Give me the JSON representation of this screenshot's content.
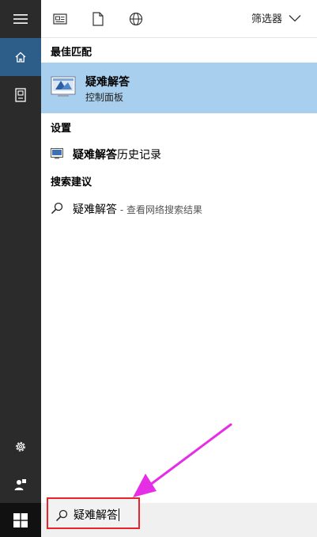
{
  "topbar": {
    "filter_label": "筛选器"
  },
  "sections": {
    "best_match": "最佳匹配",
    "settings": "设置",
    "suggestions": "搜索建议"
  },
  "best_match": {
    "title": "疑难解答",
    "subtitle": "控制面板"
  },
  "settings_item": {
    "bold": "疑难解答",
    "rest": "历史记录"
  },
  "suggestion_item": {
    "text": "疑难解答",
    "suffix": " - 查看网络搜索结果"
  },
  "search": {
    "value": "疑难解答"
  },
  "colors": {
    "rail": "#2b2b2b",
    "rail_active": "#2d5d89",
    "highlight": "#a8cfee",
    "annotation_red": "#e8232b",
    "annotation_arrow": "#e62ee6"
  },
  "icons": {
    "hamburger": "hamburger-icon",
    "home": "home-icon",
    "documents": "document-icon",
    "news": "news-icon",
    "file": "file-icon",
    "web": "globe-icon",
    "chevron": "chevron-down-icon",
    "settings": "gear-icon",
    "user": "user-icon",
    "windows": "windows-logo-icon",
    "search": "search-icon"
  }
}
